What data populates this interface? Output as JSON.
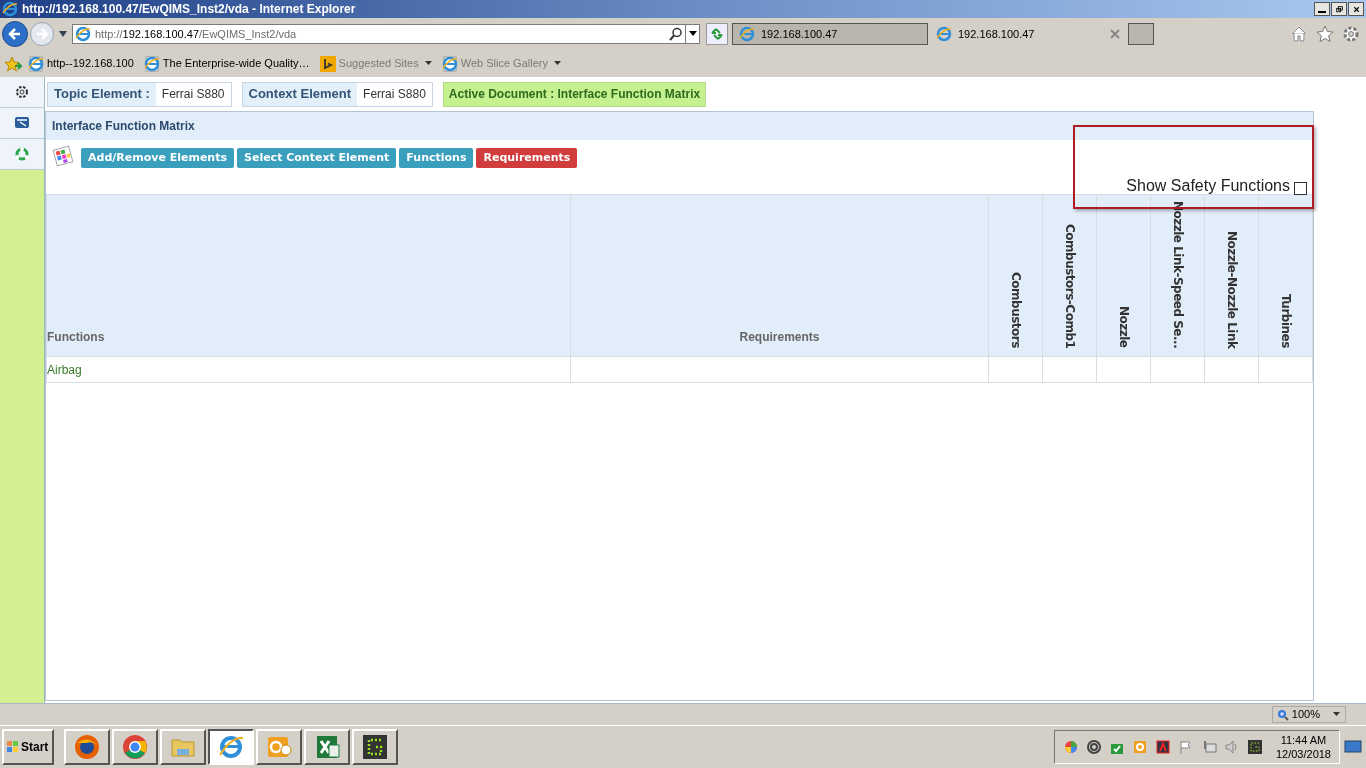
{
  "window": {
    "title": "http://192.168.100.47/EwQIMS_Inst2/vda - Internet Explorer"
  },
  "address_bar": {
    "scheme": "http://",
    "host": "192.168.100.47",
    "path": "/EwQIMS_Inst2/vda"
  },
  "browser_tabs": [
    {
      "label": "192.168.100.47",
      "selected": false
    },
    {
      "label": "192.168.100.47",
      "selected": true
    }
  ],
  "favorites": [
    {
      "label": "http--192.168.100",
      "kind": "page",
      "dimmed": false,
      "dropdown": false
    },
    {
      "label": "The Enterprise-wide Quality…",
      "kind": "page",
      "dimmed": false,
      "dropdown": false
    },
    {
      "label": "Suggested Sites",
      "kind": "bing",
      "dimmed": true,
      "dropdown": true
    },
    {
      "label": "Web Slice Gallery",
      "kind": "page",
      "dimmed": true,
      "dropdown": true
    }
  ],
  "context_bar": {
    "items": [
      {
        "label": "Topic Element :",
        "value": "Ferrai S880"
      },
      {
        "label": "Context Element",
        "value": "Ferrai S880"
      }
    ],
    "active_document": "Active Document : Interface Function Matrix"
  },
  "panel": {
    "title": "Interface Function Matrix",
    "buttons": [
      {
        "label": "Add/Remove Elements",
        "color": "#3a9fbd"
      },
      {
        "label": "Select Context Element",
        "color": "#3a9fbd"
      },
      {
        "label": "Functions",
        "color": "#3a9fbd"
      },
      {
        "label": "Requirements",
        "color": "#d13c3c"
      }
    ],
    "safety_toggle": {
      "label": "Show Safety Functions",
      "checked": false
    }
  },
  "table": {
    "columns": [
      {
        "label": "Functions",
        "kind": "left"
      },
      {
        "label": "Requirements",
        "kind": "center"
      },
      {
        "label": "Combustors",
        "kind": "vertical"
      },
      {
        "label": "Combustors-Comb1",
        "kind": "vertical"
      },
      {
        "label": "Nozzle",
        "kind": "vertical"
      },
      {
        "label": "Nozzle Link-Speed Se...",
        "kind": "vertical"
      },
      {
        "label": "Nozzle-Nozzle Link",
        "kind": "vertical"
      },
      {
        "label": "Turbines",
        "kind": "vertical"
      }
    ],
    "rows": [
      {
        "function": "Airbag"
      }
    ]
  },
  "status_bar": {
    "zoom": "100%"
  },
  "taskbar": {
    "start": "Start",
    "apps": [
      {
        "kind": "firefox",
        "selected": false
      },
      {
        "kind": "chrome",
        "selected": false
      },
      {
        "kind": "folder",
        "selected": false
      },
      {
        "kind": "ie",
        "selected": true
      },
      {
        "kind": "outlook",
        "selected": false
      },
      {
        "kind": "excel",
        "selected": false
      },
      {
        "kind": "terminal",
        "selected": false
      }
    ],
    "clock": {
      "time": "11:44 AM",
      "date": "12/03/2018"
    }
  }
}
